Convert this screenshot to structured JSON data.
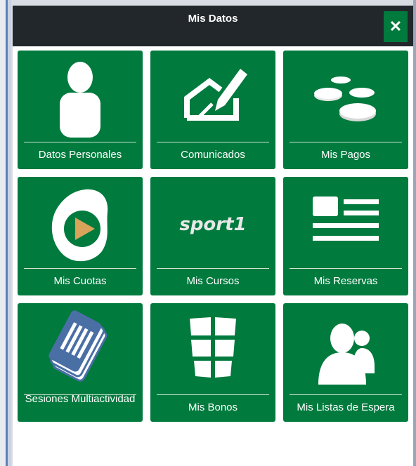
{
  "modal": {
    "title": "Mis Datos",
    "close_label": "✕"
  },
  "tiles": [
    {
      "label": "Datos Personales",
      "icon": "person-icon"
    },
    {
      "label": "Comunicados",
      "icon": "compose-icon"
    },
    {
      "label": "Mis Pagos",
      "icon": "coins-icon"
    },
    {
      "label": "Mis Cuotas",
      "icon": "play-logo-icon"
    },
    {
      "label": "Mis Cursos",
      "icon": "sport1-logo",
      "logo_text": "sport1"
    },
    {
      "label": "Mis Reservas",
      "icon": "news-list-icon"
    },
    {
      "label": "Sesiones Multiactividad",
      "icon": "ticket-stack-icon"
    },
    {
      "label": "Mis Bonos",
      "icon": "bonus-blocks-icon"
    },
    {
      "label": "Mis Listas de Espera",
      "icon": "users-icon"
    }
  ],
  "colors": {
    "header": "#22272b",
    "tile": "#007a3d",
    "accent_orange": "#d9a35a",
    "ticket_blue": "#4a6fa5"
  }
}
